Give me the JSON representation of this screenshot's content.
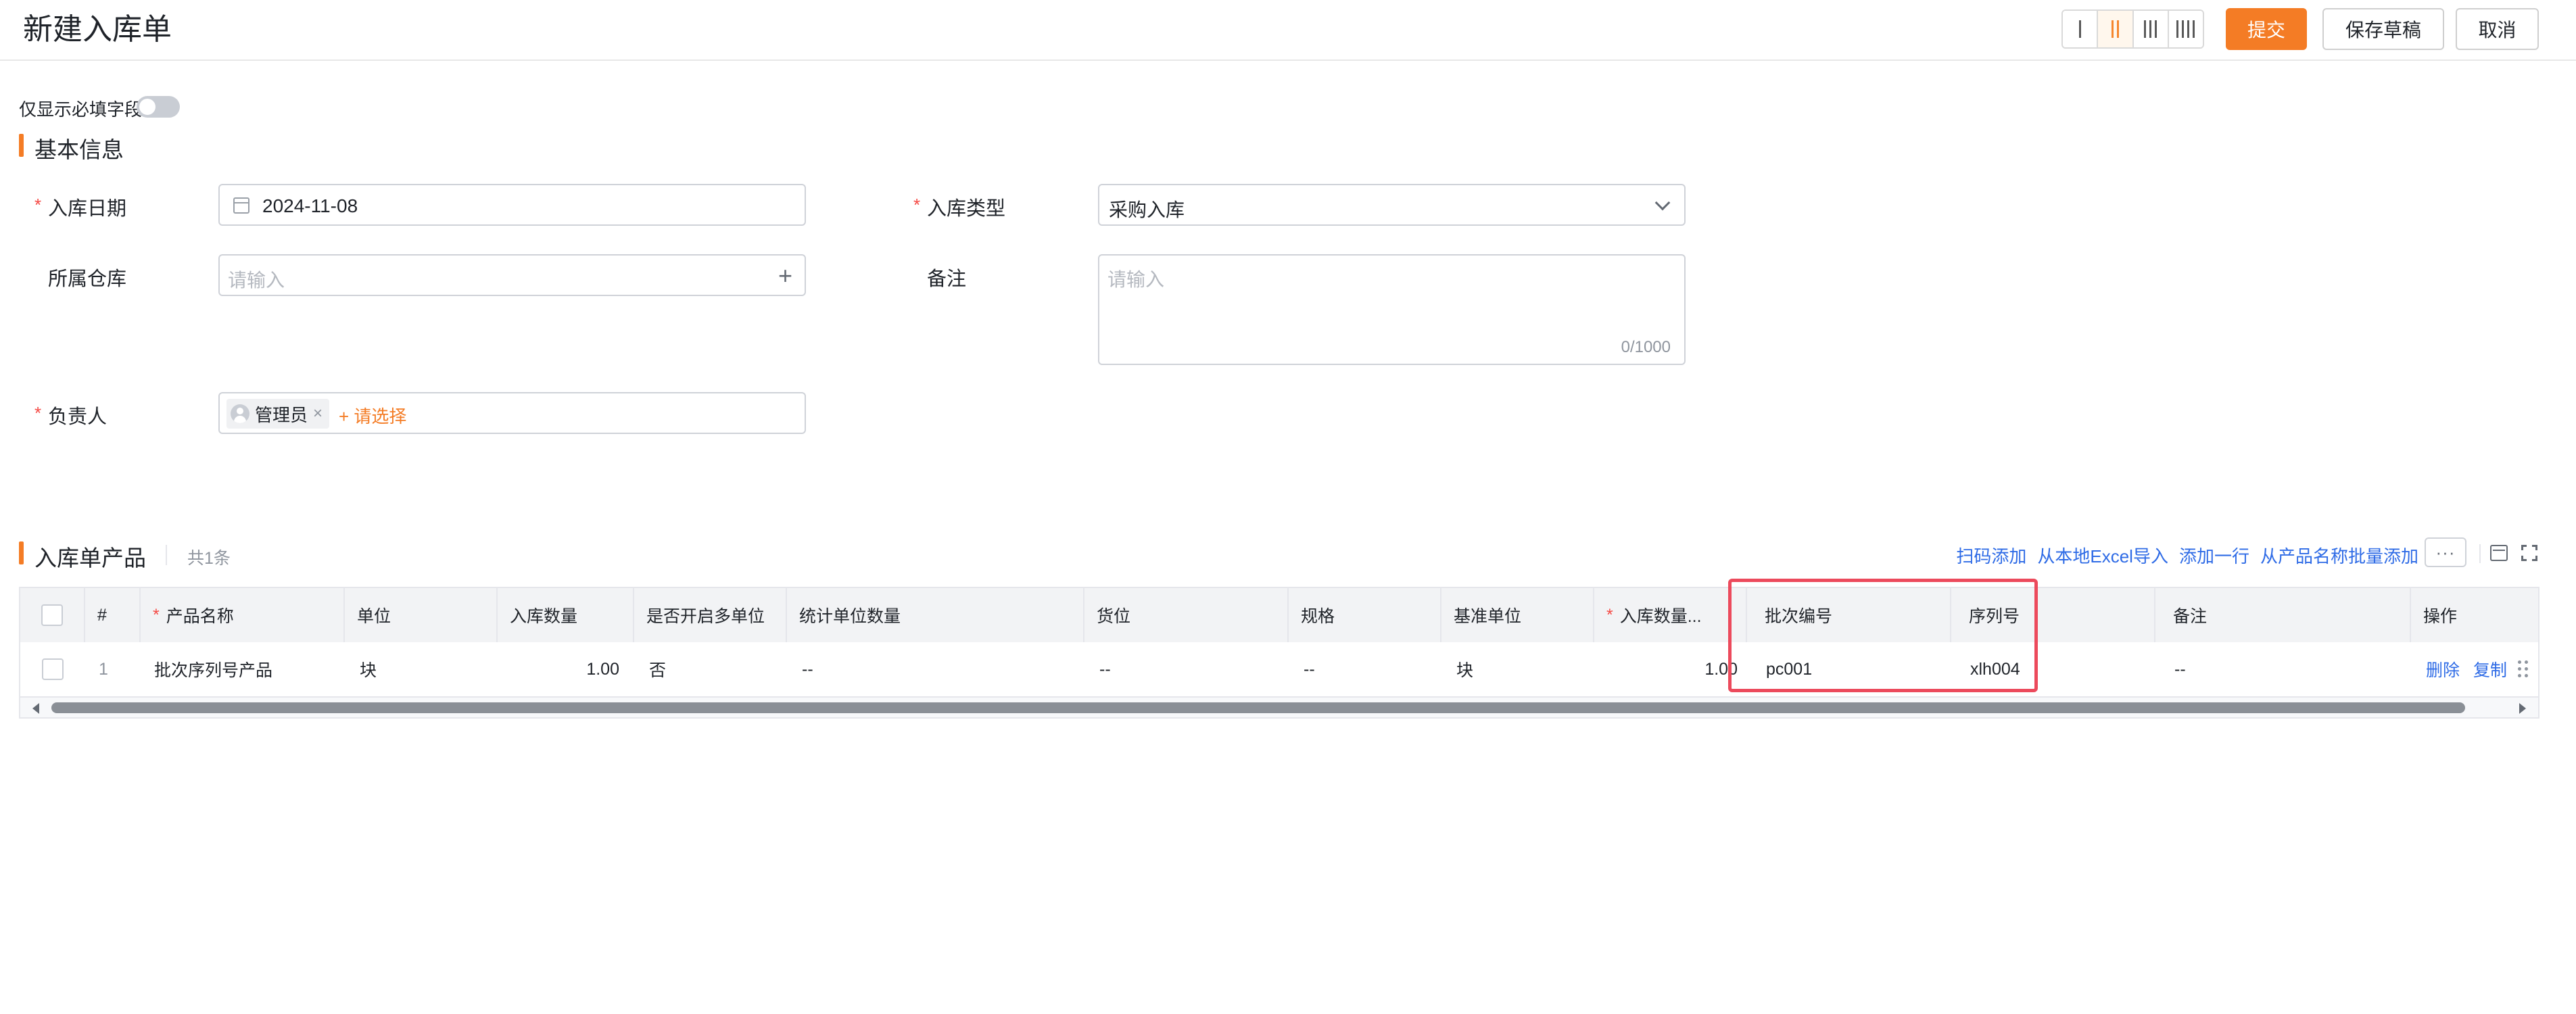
{
  "header": {
    "title": "新建入库单",
    "layout_options": [
      "1-column",
      "2-column",
      "3-column",
      "4-column"
    ],
    "active_layout": "2-column",
    "submit_label": "提交",
    "draft_label": "保存草稿",
    "cancel_label": "取消"
  },
  "required_only": {
    "label": "仅显示必填字段",
    "enabled": false
  },
  "basic_info": {
    "title": "基本信息",
    "date": {
      "label": "入库日期",
      "required": true,
      "value": "2024-11-08",
      "icon": "calendar-icon"
    },
    "type": {
      "label": "入库类型",
      "required": true,
      "value": "采购入库",
      "icon": "chevron-down-icon"
    },
    "warehouse": {
      "label": "所属仓库",
      "required": false,
      "placeholder": "请输入",
      "icon": "plus-icon"
    },
    "remark": {
      "label": "备注",
      "required": false,
      "placeholder": "请输入",
      "counter": "0/1000"
    },
    "owner": {
      "label": "负责人",
      "required": true,
      "tag": "管理员",
      "select_link": "+ 请选择"
    }
  },
  "products": {
    "title": "入库单产品",
    "count_text": "共1条",
    "actions": [
      "扫码添加",
      "从本地Excel导入",
      "添加一行",
      "从产品名称批量添加"
    ],
    "more_label": "···",
    "columns": {
      "index": "#",
      "name": "产品名称",
      "unit": "单位",
      "qty": "入库数量",
      "multi_unit": "是否开启多单位",
      "stat_qty": "统计单位数量",
      "location": "货位",
      "spec": "规格",
      "base_unit": "基准单位",
      "base_qty": "入库数量...",
      "batch": "批次编号",
      "serial": "序列号",
      "remark": "备注",
      "ops": "操作"
    },
    "rows": [
      {
        "index": "1",
        "name": "批次序列号产品",
        "unit": "块",
        "qty": "1.00",
        "multi_unit": "否",
        "stat_qty": "--",
        "location": "--",
        "spec": "--",
        "base_unit": "块",
        "base_qty": "1.00",
        "batch": "pc001",
        "serial": "xlh004",
        "remark": "--",
        "delete_label": "删除",
        "copy_label": "复制"
      }
    ]
  },
  "colors": {
    "accent": "#f47c25",
    "link": "#2e6be6",
    "required": "#f54a45",
    "highlight": "#ec4a5c"
  }
}
